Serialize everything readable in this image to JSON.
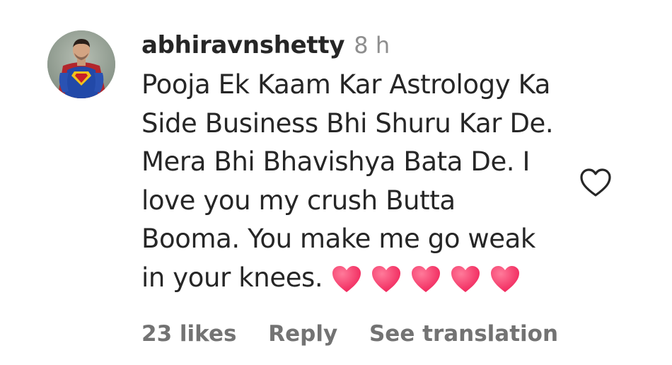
{
  "comment": {
    "username": "abhiravnshetty",
    "time_ago": "8 h",
    "text": "Pooja Ek Kaam Kar Astrology Ka Side Business Bhi Shuru Kar De. Mera Bhi Bhavishya Bata De. I love you my crush Butta Booma. You make me go weak in your knees.",
    "emoji": [
      "❤️",
      "❤️",
      "❤️",
      "❤️",
      "❤️"
    ],
    "likes_label": "23 likes",
    "reply_label": "Reply",
    "translate_label": "See translation",
    "avatar_icon": "superman-avatar",
    "like_icon": "heart-outline-icon",
    "colors": {
      "text": "#262626",
      "secondary": "#737373",
      "timestamp": "#8e8e8e",
      "emoji_heart": "#ff3b6e"
    }
  }
}
